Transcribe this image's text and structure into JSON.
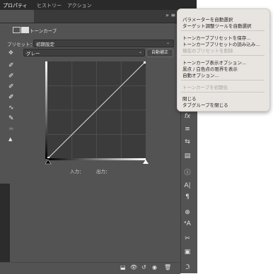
{
  "tabs": [
    {
      "label": "プロパティ"
    },
    {
      "label": "ヒストリー"
    },
    {
      "label": "アクション"
    }
  ],
  "panel_menu_glyph": "≡",
  "collapse_glyph": "»",
  "header": {
    "title": "トーンカーブ"
  },
  "preset": {
    "label": "プリセット：",
    "value": "初期設定"
  },
  "channel": {
    "value": "グレー",
    "auto_label": "自動補正"
  },
  "io": {
    "input_label": "入力：",
    "output_label": "出力："
  },
  "tools": [
    {
      "icon": "eyedropper-target-icon"
    },
    {
      "icon": "eyedropper-black-icon"
    },
    {
      "icon": "eyedropper-gray-icon"
    },
    {
      "icon": "eyedropper-white-icon"
    },
    {
      "icon": "curve-point-icon"
    },
    {
      "icon": "pencil-icon"
    },
    {
      "icon": "smooth-icon"
    },
    {
      "icon": "clipping-warning-icon"
    }
  ],
  "context_menu": {
    "items": [
      {
        "label": "パラメーターを自動選択",
        "enabled": true
      },
      {
        "label": "ターゲット調整ツールを自動選択",
        "enabled": true
      },
      {
        "label": "トーンカーブプリセットを保存...",
        "enabled": true
      },
      {
        "label": "トーンカーブプリセットの読み込み...",
        "enabled": true
      },
      {
        "label": "現在のプリセットを削除",
        "enabled": false
      },
      {
        "label": "トーンカーブ表示オプション...",
        "enabled": true
      },
      {
        "label": "黒点 / 白色点の限界を表示",
        "enabled": true
      },
      {
        "label": "自動オプション...",
        "enabled": true
      },
      {
        "label": "トーンカーブを初期化",
        "enabled": false
      },
      {
        "label": "閉じる",
        "enabled": true
      },
      {
        "label": "タブグループを閉じる",
        "enabled": true
      }
    ]
  },
  "strip_icons": [
    "fx",
    "brush-settings",
    "sliders",
    "layers",
    "info",
    "character",
    "paragraph",
    "clone-source",
    "glyphs",
    "tools",
    "frame",
    "type-on-path"
  ],
  "colors": {
    "panel": "#535353",
    "menu_bg": "#e8e4e0",
    "graph_bg": "#3b3b3b"
  }
}
